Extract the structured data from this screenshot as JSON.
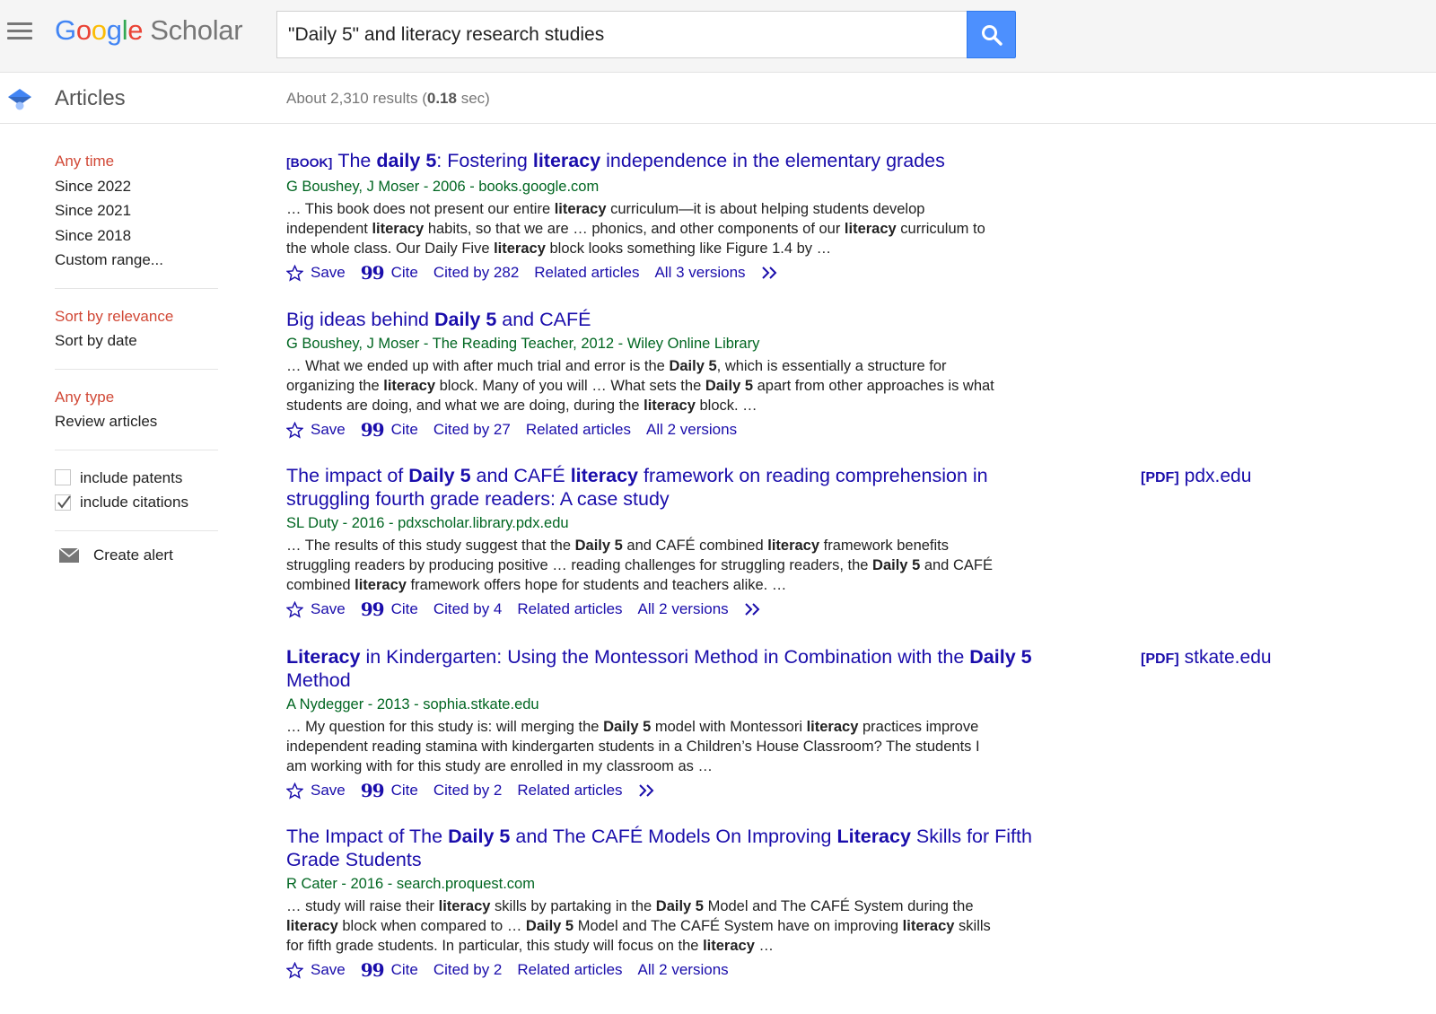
{
  "header": {
    "logo_scholar": "Scholar",
    "search_value": "\"Daily 5\" and literacy research studies"
  },
  "subheader": {
    "section": "Articles",
    "results_prefix": "About 2,310 results (",
    "results_time": "0.18",
    "results_suffix": " sec)"
  },
  "sidebar": {
    "time": [
      "Any time",
      "Since 2022",
      "Since 2021",
      "Since 2018",
      "Custom range..."
    ],
    "sort": [
      "Sort by relevance",
      "Sort by date"
    ],
    "type": [
      "Any type",
      "Review articles"
    ],
    "include_patents": "include patents",
    "include_citations": "include citations",
    "create_alert": "Create alert"
  },
  "actions": {
    "save": "Save",
    "cite": "Cite",
    "related": "Related articles"
  },
  "results": [
    {
      "tag": "[BOOK]",
      "meta": "G Boushey, J Moser - 2006 - books.google.com",
      "cited": "Cited by 282",
      "versions": "All 3 versions"
    },
    {
      "meta": "G Boushey, J Moser - The Reading Teacher, 2012 - Wiley Online Library",
      "cited": "Cited by 27",
      "versions": "All 2 versions"
    },
    {
      "meta": "SL Duty - 2016 - pdxscholar.library.pdx.edu",
      "cited": "Cited by 4",
      "versions": "All 2 versions",
      "pdf_tag": "[PDF]",
      "pdf_domain": "pdx.edu"
    },
    {
      "meta": "A Nydegger - 2013 - sophia.stkate.edu",
      "cited": "Cited by 2",
      "pdf_tag": "[PDF]",
      "pdf_domain": "stkate.edu"
    },
    {
      "meta": "R Cater - 2016 - search.proquest.com",
      "cited": "Cited by 2",
      "versions": "All 2 versions"
    }
  ],
  "rich_text": {
    "r0_title": "The <b>daily 5</b>: Fostering <b>literacy</b> independence in the elementary grades",
    "r0_snippet": "… This book does not present our entire <b>literacy</b> curriculum—it is about helping students develop independent <b>literacy</b> habits, so that we are … phonics, and other components of our <b>literacy</b> curriculum to the whole class. Our Daily Five <b>literacy</b> block looks something like Figure 1.4 by …",
    "r1_title": "Big ideas behind <b>Daily 5</b> and CAFÉ",
    "r1_snippet": "… What we ended up with after much trial and error is the <b>Daily 5</b>, which is essentially a structure for organizing the <b>literacy</b> block. Many of you will … What sets the <b>Daily 5</b> apart from other approaches is what students are doing, and what we are doing, during the <b>literacy</b> block. …",
    "r2_title": "The impact of <b>Daily 5</b> and CAFÉ <b>literacy</b> framework on reading comprehension in struggling fourth grade readers: A case study",
    "r2_snippet": "… The results of this study suggest that the <b>Daily 5</b> and CAFÉ combined <b>literacy</b> framework benefits struggling readers by producing positive … reading challenges for struggling readers, the <b>Daily 5</b> and CAFÉ combined <b>literacy</b> framework offers hope for students and teachers alike. …",
    "r3_title": "<b>Literacy</b> in Kindergarten: Using the Montessori Method in Combination with the <b>Daily 5</b> Method",
    "r3_snippet": "… My question for this study is: will merging the <b>Daily 5</b> model with Montessori <b>literacy</b> practices improve independent reading stamina with kindergarten students in a Children’s House Classroom? The students I am working with for this study are enrolled in my classroom as …",
    "r4_title": "The Impact of The <b>Daily 5</b> and The CAFÉ Models On Improving <b>Literacy</b> Skills for Fifth Grade Students",
    "r4_snippet": "… study will raise their <b>literacy</b> skills by partaking in the <b>Daily 5</b> Model and The CAFÉ System during the <b>literacy</b> block when compared to … <b>Daily 5</b> Model and The CAFÉ System have on improving <b>literacy</b> skills for fifth grade students. In particular, this study will focus on the <b>literacy</b> …"
  },
  "icons": {
    "menu": "menu-icon",
    "search": "search-icon",
    "cap": "graduation-cap-icon",
    "star": "star-icon",
    "quote": "quote-icon",
    "more": "double-chevron-icon",
    "mail": "envelope-icon"
  },
  "colors": {
    "link": "#1a0dab",
    "meta": "#006621",
    "active": "#d14836",
    "search_button": "#4d90fe"
  }
}
